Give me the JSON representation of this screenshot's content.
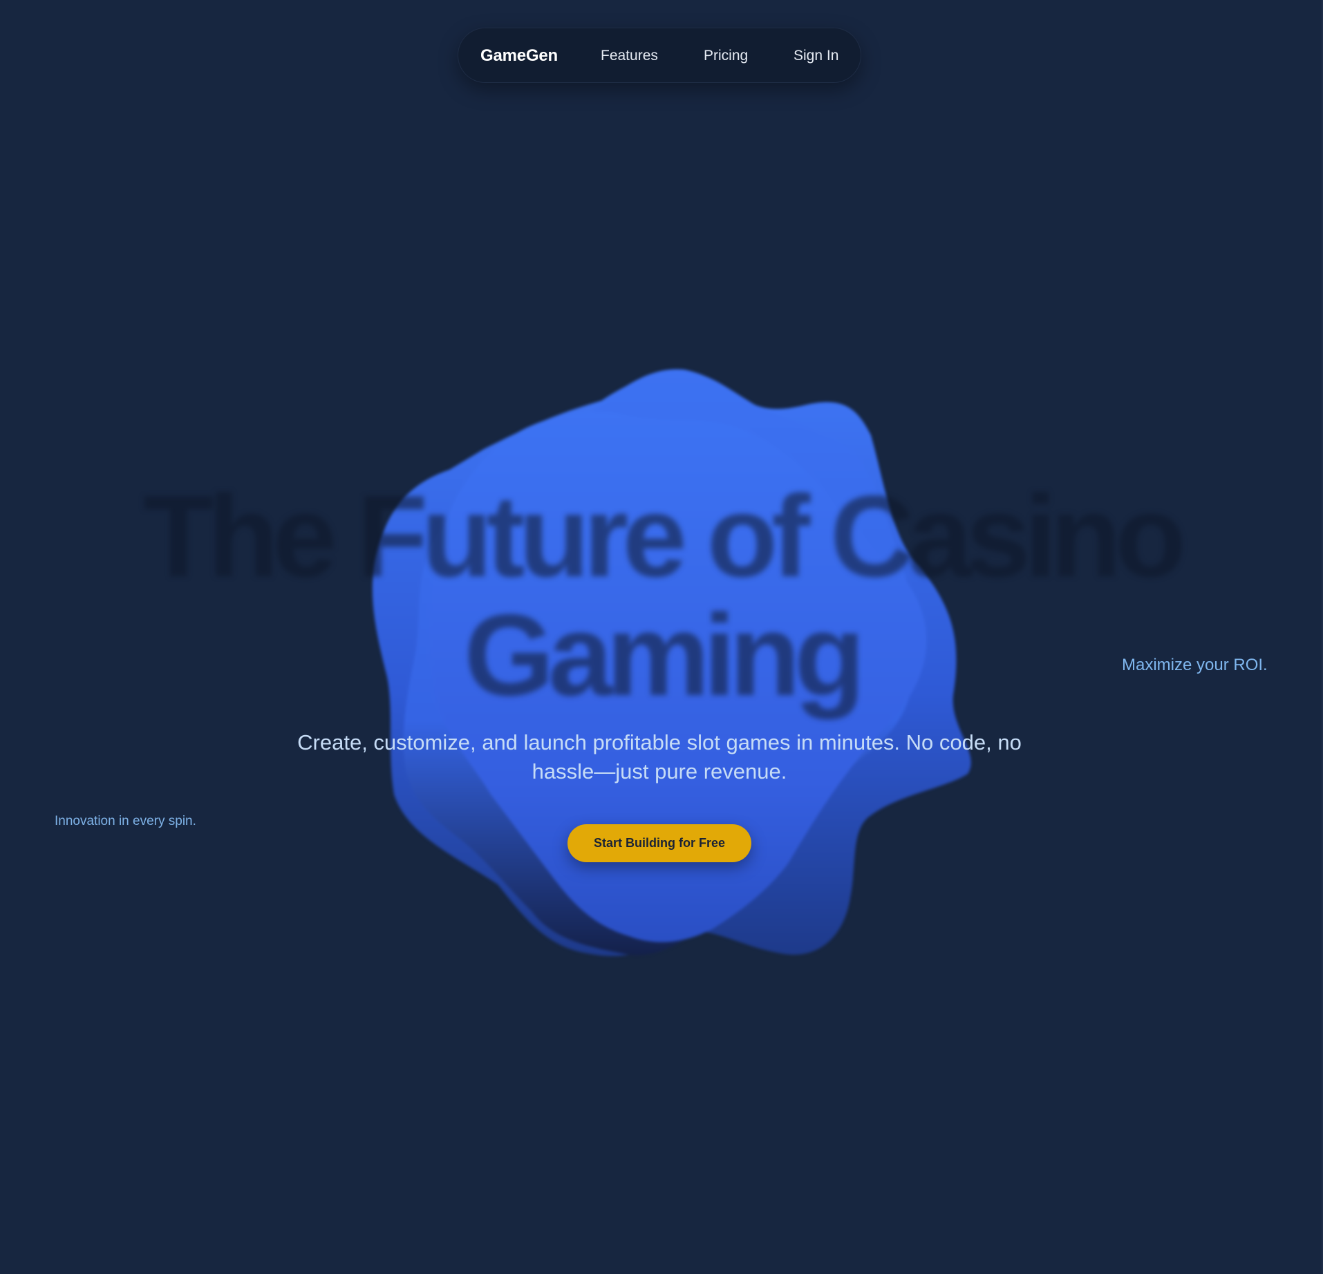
{
  "nav": {
    "brand": "GameGen",
    "links": [
      {
        "label": "Features"
      },
      {
        "label": "Pricing"
      },
      {
        "label": "Sign In"
      }
    ]
  },
  "hero": {
    "title_line1": "The Future of Casino",
    "title_line2": "Gaming",
    "subtitle": "Create, customize, and launch profitable slot games in minutes. No code, no hassle—just pure revenue.",
    "cta_label": "Start Building for Free"
  },
  "taglines": {
    "left": "Innovation in every spin.",
    "right": "Maximize your ROI."
  },
  "colors": {
    "background": "#172640",
    "nav_background": "#111d31",
    "blob_blue": "#3d72f2",
    "cta_yellow": "#e2a907",
    "accent_text": "#7fb6ee"
  }
}
